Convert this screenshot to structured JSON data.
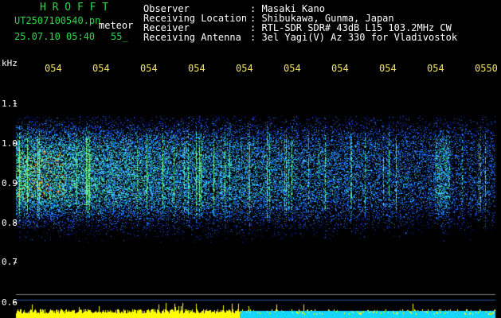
{
  "header": {
    "app_title": "H R O F F T",
    "filename": "UT2507100540.pn",
    "mode": "meteor",
    "datetime": "25.07.10 05:40",
    "count": "55_",
    "info_labels": [
      "Observer",
      "Receiving Location",
      "Receiver",
      "Receiving Antenna"
    ],
    "info_values": [
      ": Masaki Kano",
      ": Shibukawa, Gunma, Japan",
      ": RTL-SDR SDR# 43dB L15 103.2MHz CW",
      ": 3el Yagi(V) Az 330 for Vladivostok"
    ]
  },
  "spectrogram": {
    "y_unit": "kHz",
    "y_ticks": [
      "1.1",
      "1.0",
      "0.9",
      "0.8",
      "0.7",
      "0.6"
    ],
    "y_tick_values": [
      1.1,
      1.0,
      0.9,
      0.8,
      0.7,
      0.6
    ],
    "time_ticks": [
      "054",
      "054",
      "054",
      "054",
      "054",
      "054",
      "054",
      "054",
      "054",
      "0550"
    ],
    "colors": {
      "background": "#000000",
      "signal_low": "#0a1f9c",
      "signal_mid": "#1f6bff",
      "signal_high": "#3be0c8",
      "hot": "#ffd400",
      "bottom_bar": "#ffff00",
      "bottom_bar_alt": "#14d7ff",
      "header_green": "#2bd84a",
      "time_label": "#f2e25a"
    }
  }
}
